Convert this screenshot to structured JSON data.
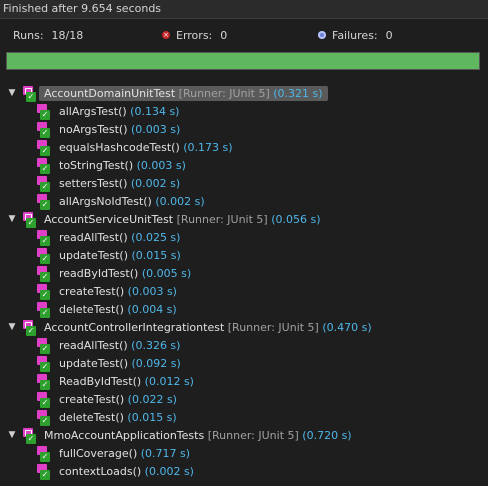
{
  "header": {
    "title": "Finished after 9.654 seconds"
  },
  "summary": {
    "runs_label": "Runs:",
    "runs_value": "18/18",
    "errors_label": "Errors:",
    "errors_value": "0",
    "failures_label": "Failures:",
    "failures_value": "0"
  },
  "progress": {
    "fraction": 1.0,
    "color": "#5fb75f"
  },
  "colors": {
    "time": "#4fb6e8",
    "pass": "#2ea02e",
    "class_icon": "#e040c8",
    "runner": "#a0a0a0"
  },
  "tree": {
    "suites": [
      {
        "name": "AccountDomainUnitTest",
        "runner": "[Runner: JUnit 5]",
        "time": "(0.321 s)",
        "selected": true,
        "cases": [
          {
            "name": "allArgsTest()",
            "time": "(0.134 s)"
          },
          {
            "name": "noArgsTest()",
            "time": "(0.003 s)"
          },
          {
            "name": "equalsHashcodeTest()",
            "time": "(0.173 s)"
          },
          {
            "name": "toStringTest()",
            "time": "(0.003 s)"
          },
          {
            "name": "settersTest()",
            "time": "(0.002 s)"
          },
          {
            "name": "allArgsNoIdTest()",
            "time": "(0.002 s)"
          }
        ]
      },
      {
        "name": "AccountServiceUnitTest",
        "runner": "[Runner: JUnit 5]",
        "time": "(0.056 s)",
        "selected": false,
        "cases": [
          {
            "name": "readAllTest()",
            "time": "(0.025 s)"
          },
          {
            "name": "updateTest()",
            "time": "(0.015 s)"
          },
          {
            "name": "readByIdTest()",
            "time": "(0.005 s)"
          },
          {
            "name": "createTest()",
            "time": "(0.003 s)"
          },
          {
            "name": "deleteTest()",
            "time": "(0.004 s)"
          }
        ]
      },
      {
        "name": "AccountControllerIntegrationtest",
        "runner": "[Runner: JUnit 5]",
        "time": "(0.470 s)",
        "selected": false,
        "cases": [
          {
            "name": "readAllTest()",
            "time": "(0.326 s)"
          },
          {
            "name": "updateTest()",
            "time": "(0.092 s)"
          },
          {
            "name": "ReadByIdTest()",
            "time": "(0.012 s)"
          },
          {
            "name": "createTest()",
            "time": "(0.022 s)"
          },
          {
            "name": "deleteTest()",
            "time": "(0.015 s)"
          }
        ]
      },
      {
        "name": "MmoAccountApplicationTests",
        "runner": "[Runner: JUnit 5]",
        "time": "(0.720 s)",
        "selected": false,
        "cases": [
          {
            "name": "fullCoverage()",
            "time": "(0.717 s)"
          },
          {
            "name": "contextLoads()",
            "time": "(0.002 s)"
          }
        ]
      }
    ]
  }
}
